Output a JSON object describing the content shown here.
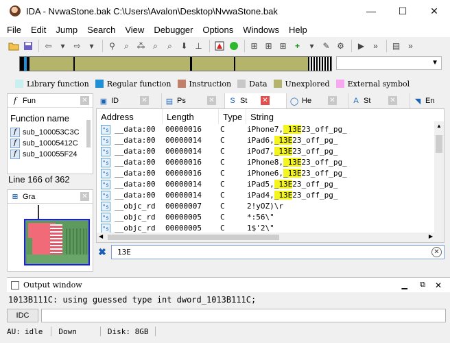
{
  "window": {
    "title": "IDA - NvwaStone.bak C:\\Users\\Avalon\\Desktop\\NvwaStone.bak",
    "minimize": "—",
    "maximize": "☐",
    "close": "✕"
  },
  "menu": [
    "File",
    "Edit",
    "Jump",
    "Search",
    "View",
    "Debugger",
    "Options",
    "Windows",
    "Help"
  ],
  "legend": [
    {
      "label": "Library function",
      "color": "#c8f0f0"
    },
    {
      "label": "Regular function",
      "color": "#1e90d8"
    },
    {
      "label": "Instruction",
      "color": "#c0806a"
    },
    {
      "label": "Data",
      "color": "#c8c8c8"
    },
    {
      "label": "Unexplored",
      "color": "#b4b46a"
    },
    {
      "label": "External symbol",
      "color": "#f7a8f0"
    }
  ],
  "functions_pane": {
    "tab_label": "Fun",
    "header": "Function name",
    "items": [
      "sub_100053C3C",
      "sub_10005412C",
      "sub_100055F24"
    ],
    "line_status": "Line 166 of 362"
  },
  "graph_pane": {
    "tab_label": "Gra"
  },
  "main_tabs": [
    {
      "label": "ID"
    },
    {
      "label": "Ps"
    },
    {
      "label": "St"
    },
    {
      "label": "He"
    },
    {
      "label": "St"
    },
    {
      "label": "En"
    }
  ],
  "strings": {
    "columns": [
      "Address",
      "Length",
      "Type",
      "String"
    ],
    "rows": [
      {
        "address": "__data:00",
        "length": "00000016",
        "type": "C",
        "pre": "iPhone7,",
        "match": "_13E",
        "post": "23_off_pg_"
      },
      {
        "address": "__data:00",
        "length": "00000014",
        "type": "C",
        "pre": "iPad6,",
        "match": "_13E",
        "post": "23_off_pg_"
      },
      {
        "address": "__data:00",
        "length": "00000014",
        "type": "C",
        "pre": "iPod7,",
        "match": "_13E",
        "post": "23_off_pg_"
      },
      {
        "address": "__data:00",
        "length": "00000016",
        "type": "C",
        "pre": "iPhone8,",
        "match": "_13E",
        "post": "23_off_pg_"
      },
      {
        "address": "__data:00",
        "length": "00000016",
        "type": "C",
        "pre": "iPhone6,",
        "match": "_13E",
        "post": "23_off_pg_"
      },
      {
        "address": "__data:00",
        "length": "00000014",
        "type": "C",
        "pre": "iPad5,",
        "match": "_13E",
        "post": "23_off_pg_"
      },
      {
        "address": "__data:00",
        "length": "00000014",
        "type": "C",
        "pre": "iPad4,",
        "match": "_13E",
        "post": "23_off_pg_"
      },
      {
        "address": "__objc_rd",
        "length": "00000007",
        "type": "C",
        "pre": "2!yOZ)\\r",
        "match": "",
        "post": ""
      },
      {
        "address": "__objc_rd",
        "length": "00000005",
        "type": "C",
        "pre": "*:56\\\"",
        "match": "",
        "post": ""
      },
      {
        "address": "__objc_rd",
        "length": "00000005",
        "type": "C",
        "pre": "1$'2\\\"",
        "match": "",
        "post": ""
      }
    ]
  },
  "search": {
    "value": "13E"
  },
  "output": {
    "title": "Output window",
    "text": "1013B111C: using guessed type int dword_1013B111C;",
    "idc_label": "IDC"
  },
  "status": {
    "au": "AU:",
    "state": "idle",
    "direction": "Down",
    "disk": "Disk: 8GB"
  }
}
